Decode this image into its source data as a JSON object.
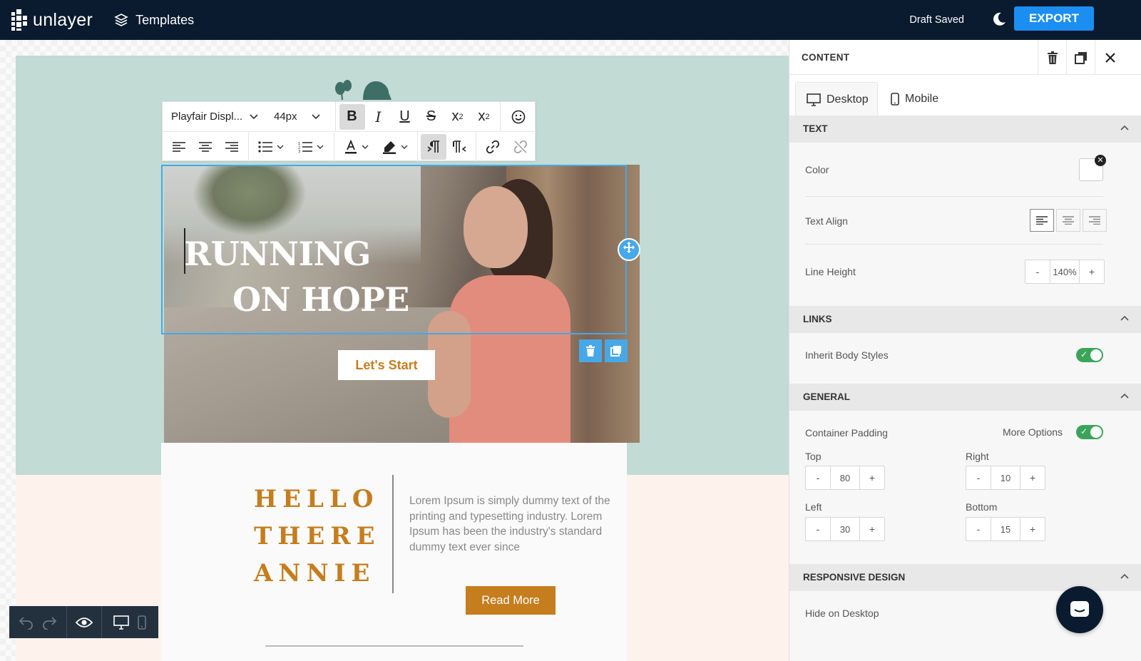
{
  "header": {
    "brand": "unlayer",
    "templates_label": "Templates",
    "status": "Draft Saved",
    "export_label": "EXPORT"
  },
  "toolbar": {
    "font_family": "Playfair Displ...",
    "font_size": "44px"
  },
  "email": {
    "hero_line1": "RUNNING",
    "hero_line2": "ON HOPE",
    "cta_label": "Let's Start",
    "hello_lines": [
      "HELLO",
      "THERE",
      "ANNIE"
    ],
    "body_text": "Lorem Ipsum is simply dummy text of the printing and typesetting industry. Lorem Ipsum has been the industry's standard dummy text ever since",
    "read_more_label": "Read More"
  },
  "panel": {
    "title": "CONTENT",
    "tabs": [
      {
        "label": "Desktop",
        "active": true
      },
      {
        "label": "Mobile",
        "active": false
      }
    ],
    "sections": {
      "text": {
        "title": "TEXT",
        "color_label": "Color",
        "text_align_label": "Text Align",
        "text_align_value": "left",
        "line_height_label": "Line Height",
        "line_height_value": "140%"
      },
      "links": {
        "title": "LINKS",
        "inherit_label": "Inherit Body Styles",
        "inherit_on": true
      },
      "general": {
        "title": "GENERAL",
        "container_padding_label": "Container Padding",
        "more_options_label": "More Options",
        "more_options_on": true,
        "top_label": "Top",
        "top_value": "80",
        "right_label": "Right",
        "right_value": "10",
        "left_label": "Left",
        "left_value": "30",
        "bottom_label": "Bottom",
        "bottom_value": "15"
      },
      "responsive": {
        "title": "RESPONSIVE DESIGN",
        "hide_desktop_label": "Hide on Desktop"
      }
    }
  },
  "colors": {
    "topbar": "#0a1a2f",
    "accent_blue": "#1b8ef2",
    "brand_orange": "#c57d1d",
    "mint": "#c2dbd4",
    "peach": "#fdf2ec",
    "toggle_green": "#3aa55a"
  }
}
